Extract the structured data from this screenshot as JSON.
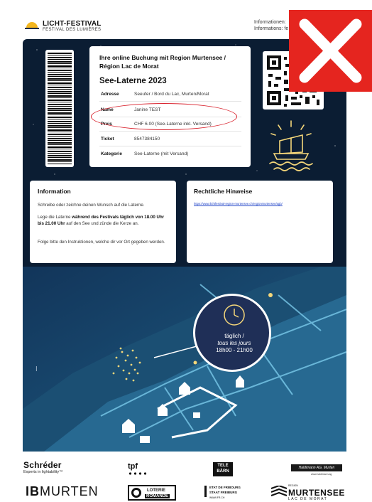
{
  "header": {
    "brand_title": "LICHT-FESTIVAL",
    "brand_subtitle": "FESTIVAL DES LUMIÈRES",
    "info_line_1": "Informationen:",
    "info_line_2": "Informations: fe"
  },
  "ticket": {
    "heading": "Ihre online Buchung mit Region Murtensee / Région Lac de Morat",
    "event_title": "See-Laterne 2023",
    "rows": [
      {
        "label": "Adresse",
        "value": "Seeufer / Bord du Lac, Murten/Morat"
      },
      {
        "label": "Name",
        "value": "Janine TEST"
      },
      {
        "label": "Preis",
        "value": "CHF 6.00 (See-Laterne inkl. Versand)"
      },
      {
        "label": "Ticket",
        "value": "8547384150"
      },
      {
        "label": "Kategorie",
        "value": "See-Laterne (mit Versand)"
      }
    ]
  },
  "information": {
    "title": "Information",
    "para1": "Schreibe oder zeichne deinen Wunsch auf die Laterne.",
    "para2_pre": "Lege die Laterne ",
    "para2_bold": "während des Festivals täglich von 18.00 Uhr bis 21.00 Uhr",
    "para2_post": " auf den See und zünde die Kerze an.",
    "para3": "Folge bitte den Instruktionen, welche dir vor Ort gegeben werden."
  },
  "legal": {
    "title": "Rechtliche Hinweise",
    "link": "https://www.lichtfestival-region-murtensee.ch/regionmurtensee/agb/"
  },
  "map_badge": {
    "line1": "täglich /",
    "line2": "tous les jours",
    "line3": "18h00 - 21h00"
  },
  "sponsors": {
    "schreder": "Schréder",
    "schreder_sub": "Experts in lightability™",
    "tpf": "tpf",
    "telebarn_1": "TELE",
    "telebarn_2": "BÄRN",
    "haldimann": "Haldimann AG, Murten",
    "haldimann_sub": "www.haldimann.ag",
    "ib_bold": "IB",
    "ib_rest": "MURTEN",
    "loterie_1": "LOTERIE",
    "loterie_2": "ROMANDE",
    "etat_1": "ETAT DE FRIBOURG",
    "etat_2": "STAAT FREIBURG",
    "etat_3": "WWW.FR.CH",
    "murtensee_small": "REGION",
    "murtensee_big": "MURTENSEE",
    "murtensee_sub": "LAC DE MORAT"
  },
  "colors": {
    "panel_bg": "#0b1d33",
    "close_red": "#e5251f",
    "highlight_red": "#d9232e",
    "lantern_gold": "#f5d77a",
    "badge_bg": "#1f2f57"
  },
  "icons": [
    "sun-logo-icon",
    "close-icon",
    "barcode-icon",
    "qr-code-icon",
    "lantern-icon",
    "clock-icon",
    "text-cursor-icon"
  ]
}
